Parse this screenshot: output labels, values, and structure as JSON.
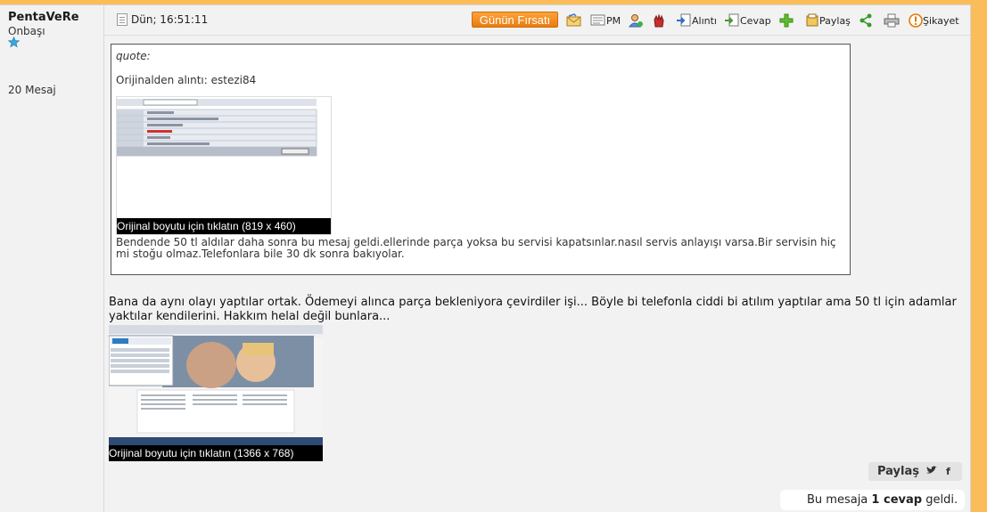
{
  "user": {
    "name": "PentaVeRe",
    "rank": "Onbaşı",
    "message_count": "20 Mesaj",
    "star_color": "#3aa6dd"
  },
  "toolbar": {
    "date": "Dün; 16:51:11",
    "deal_label": "Günün Fırsatı",
    "pm_label": "PM",
    "quote_label": "Alıntı",
    "reply_label": "Cevap",
    "share_label": "Paylaş",
    "report_label": "Şikayet",
    "icons": [
      "envelope-icon",
      "add-contact-icon",
      "block-hand-icon",
      "quote-icon",
      "reply-icon",
      "plus-icon",
      "share-icon",
      "print-icon",
      "warning-icon"
    ]
  },
  "quote": {
    "header": "quote:",
    "from": "Orijinalden alıntı: estezi84",
    "image_caption": "Orijinal boyutu için tıklatın (819 x 460)",
    "text": "Bendende 50 tl aldılar daha sonra bu mesaj geldi.ellerinde parça yoksa bu servisi kapatsınlar.nasıl servis anlayışı varsa.Bir servisin hiç mi stoğu olmaz.Telefonlara bile 30 dk sonra bakıyolar."
  },
  "post": {
    "text": "Bana da aynı olayı yaptılar ortak. Ödemeyi alınca parça bekleniyora çevirdiler işi... Böyle bi telefonla ciddi bi atılım yaptılar ama 50 tl için adamlar yaktılar kendilerini. Hakkım helal değil bunlara...",
    "image_caption": "Orijinal boyutu için tıklatın (1366 x 768)"
  },
  "footer": {
    "share_label": "Paylaş",
    "reply_count_prefix": "Bu mesaja",
    "reply_count": "1 cevap",
    "reply_count_suffix": "geldi."
  },
  "colors": {
    "page_background": "#fbbd5a",
    "post_background": "#f2f2f2",
    "deal_button": "#f58a1f"
  }
}
